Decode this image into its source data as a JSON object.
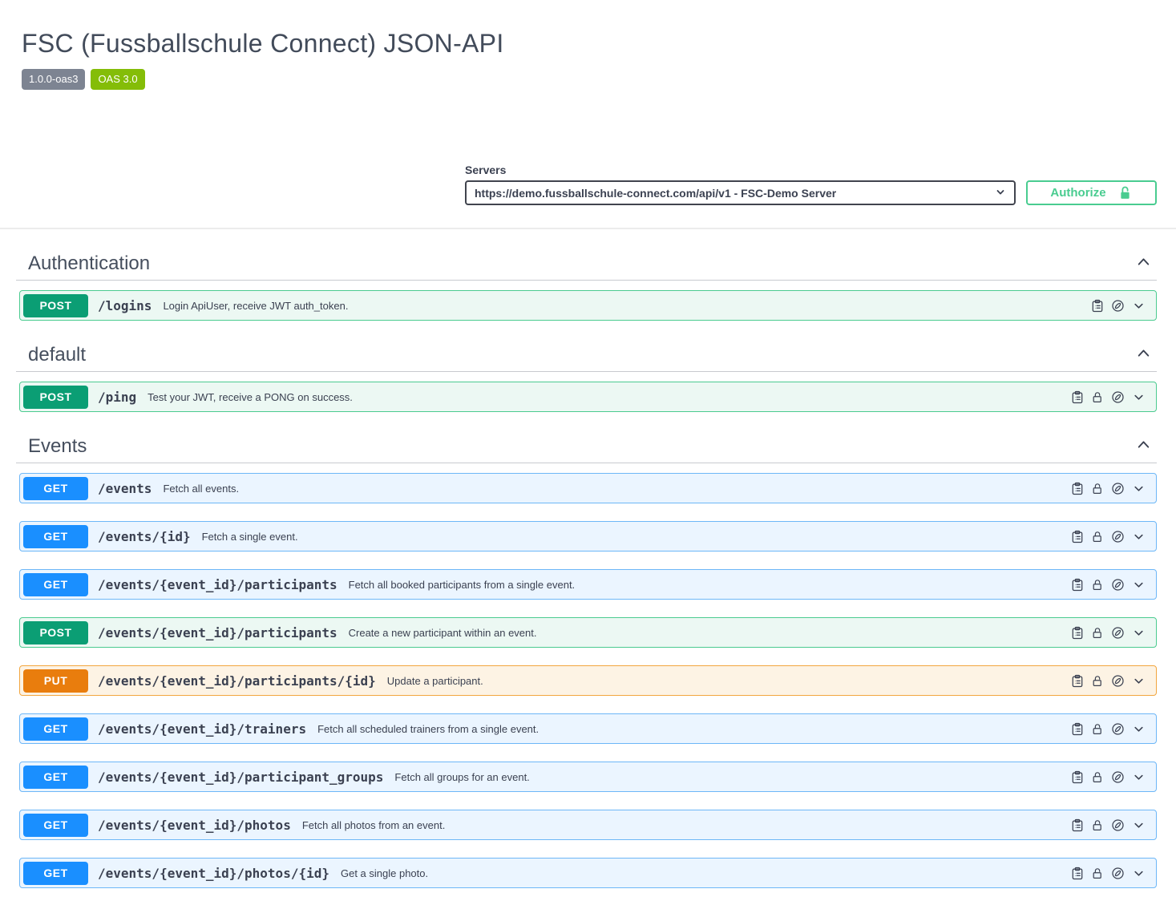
{
  "page": {
    "title": "FSC (Fussballschule Connect) JSON-API",
    "version_badge": "1.0.0-oas3",
    "oas_badge": "OAS 3.0"
  },
  "servers": {
    "label": "Servers",
    "selected_option": "https://demo.fussballschule-connect.com/api/v1 - FSC-Demo Server"
  },
  "authorize": {
    "label": "Authorize",
    "lock_state": "unlocked"
  },
  "colors": {
    "get_badge": "#1a8fff",
    "post_badge": "#0b9e74",
    "put_badge": "#e97d0d",
    "get_row_bg": "#ebf5ff",
    "post_row_bg": "#ecf8f3",
    "put_row_bg": "#fdf3e4",
    "authorize_green": "#49cc90",
    "version_badge_bg": "#7d8492",
    "oas_badge_bg": "#84bd08",
    "text": "#3b4151"
  },
  "sections": [
    {
      "name": "Authentication",
      "expanded": true,
      "operations": [
        {
          "method": "POST",
          "path": "/logins",
          "summary": "Login ApiUser, receive JWT auth_token.",
          "requires_auth": false
        }
      ]
    },
    {
      "name": "default",
      "expanded": true,
      "operations": [
        {
          "method": "POST",
          "path": "/ping",
          "summary": "Test your JWT, receive a PONG on success.",
          "requires_auth": true
        }
      ]
    },
    {
      "name": "Events",
      "expanded": true,
      "operations": [
        {
          "method": "GET",
          "path": "/events",
          "summary": "Fetch all events.",
          "requires_auth": true
        },
        {
          "method": "GET",
          "path": "/events/{id}",
          "summary": "Fetch a single event.",
          "requires_auth": true
        },
        {
          "method": "GET",
          "path": "/events/{event_id}/participants",
          "summary": "Fetch all booked participants from a single event.",
          "requires_auth": true
        },
        {
          "method": "POST",
          "path": "/events/{event_id}/participants",
          "summary": "Create a new participant within an event.",
          "requires_auth": true
        },
        {
          "method": "PUT",
          "path": "/events/{event_id}/participants/{id}",
          "summary": "Update a participant.",
          "requires_auth": true
        },
        {
          "method": "GET",
          "path": "/events/{event_id}/trainers",
          "summary": "Fetch all scheduled trainers from a single event.",
          "requires_auth": true
        },
        {
          "method": "GET",
          "path": "/events/{event_id}/participant_groups",
          "summary": "Fetch all groups for an event.",
          "requires_auth": true
        },
        {
          "method": "GET",
          "path": "/events/{event_id}/photos",
          "summary": "Fetch all photos from an event.",
          "requires_auth": true
        },
        {
          "method": "GET",
          "path": "/events/{event_id}/photos/{id}",
          "summary": "Get a single photo.",
          "requires_auth": true
        }
      ]
    }
  ]
}
